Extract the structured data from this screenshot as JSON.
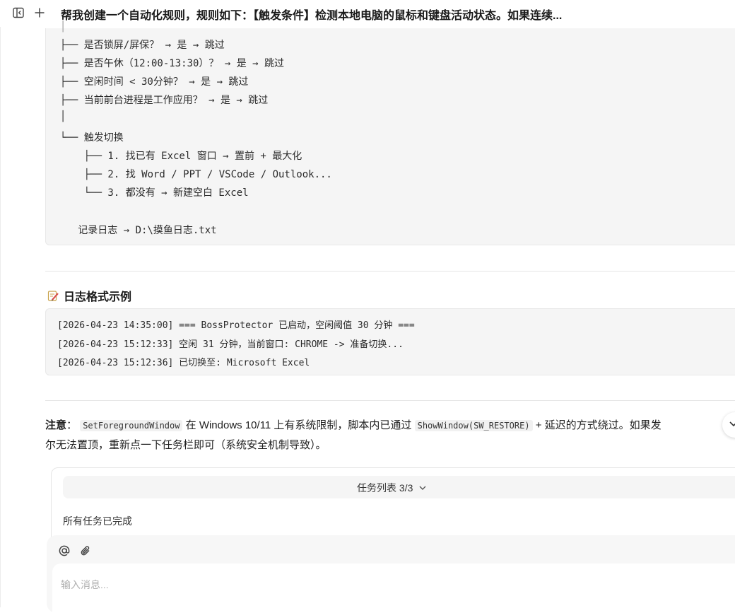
{
  "header": {
    "title": "帮我创建一个自动化规则，规则如下：【触发条件】检测本地电脑的鼠标和键盘活动状态。如果连续...",
    "sidebar_toggle_icon": "sidebar-toggle-icon",
    "new_chat_icon": "plus-icon"
  },
  "tree": {
    "lines": [
      "├── 是否锁屏/屏保？ → 是 → 跳过",
      "├── 是否午休（12:00-13:30）？ → 是 → 跳过",
      "├── 空闲时间 < 30分钟？ → 是 → 跳过",
      "├── 当前前台进程是工作应用？ → 是 → 跳过",
      "│",
      "└── 触发切换",
      "    ├── 1. 找已有 Excel 窗口 → 置前 + 最大化",
      "    ├── 2. 找 Word / PPT / VSCode / Outlook...",
      "    └── 3. 都没有 → 新建空白 Excel",
      "",
      "   记录日志 → D:\\摸鱼日志.txt"
    ]
  },
  "log_section": {
    "title": "日志格式示例",
    "icon": "memo-icon",
    "lines": [
      "[2026-04-23 14:35:00] === BossProtector 已启动，空闲阈值 30 分钟 ===",
      "[2026-04-23 15:12:33] 空闲 31 分钟，当前窗口: CHROME -> 准备切换...",
      "[2026-04-23 15:12:36] 已切换至: Microsoft Excel"
    ]
  },
  "note": {
    "label": "注意",
    "colon": "：",
    "code1": "SetForegroundWindow",
    "text1": " 在 Windows 10/11 上有系统限制，脚本内已通过 ",
    "code2": "ShowWindow(SW_RESTORE)",
    "text2": " + 延迟的方式绕过。如果发",
    "text3": "尔无法置顶，重新点一下任务栏即可（系统安全机制导致）。"
  },
  "tasks": {
    "title": "任务列表 3/3",
    "status": "所有任务已完成"
  },
  "composer": {
    "placeholder": "输入消息..."
  }
}
